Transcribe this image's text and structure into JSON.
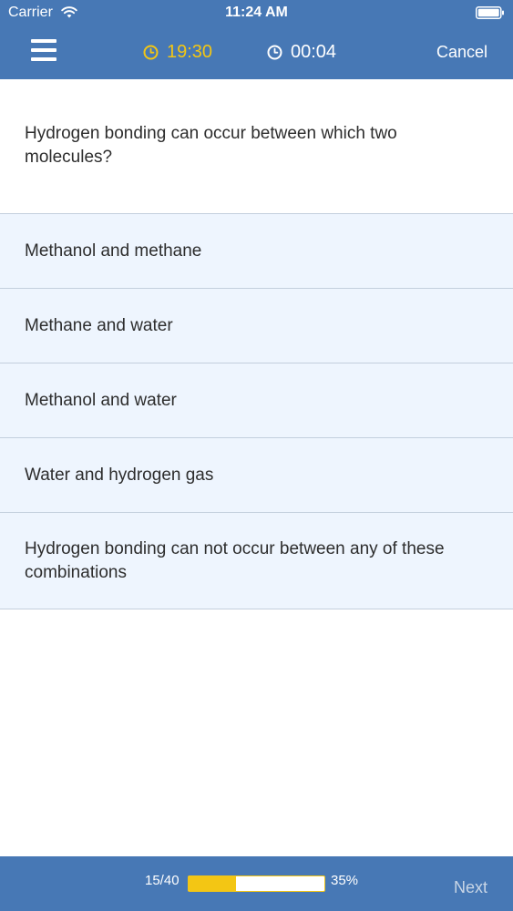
{
  "status_bar": {
    "carrier": "Carrier",
    "time": "11:24 AM",
    "wifi_icon": "wifi-icon",
    "battery_icon": "battery-icon"
  },
  "nav_bar": {
    "menu_icon": "hamburger-menu-icon",
    "time_limit": "19:30",
    "time_limit_icon": "clock-icon",
    "time_elapsed": "00:04",
    "time_elapsed_icon": "clock-icon",
    "cancel_label": "Cancel"
  },
  "question": {
    "text": "Hydrogen bonding can occur between which two molecules?"
  },
  "answers": [
    {
      "label": "Methanol and methane"
    },
    {
      "label": "Methane and water"
    },
    {
      "label": "Methanol and water"
    },
    {
      "label": "Water and hydrogen gas"
    },
    {
      "label": "Hydrogen bonding can not occur between any of these combinations"
    }
  ],
  "footer": {
    "progress_count": "15/40",
    "progress_percent_label": "35%",
    "progress_fraction": 0.35,
    "next_label": "Next"
  },
  "colors": {
    "bar_background": "#4778b5",
    "accent_yellow": "#f3c614",
    "answer_background": "#eef5fe",
    "divider": "#c3cfdd"
  }
}
